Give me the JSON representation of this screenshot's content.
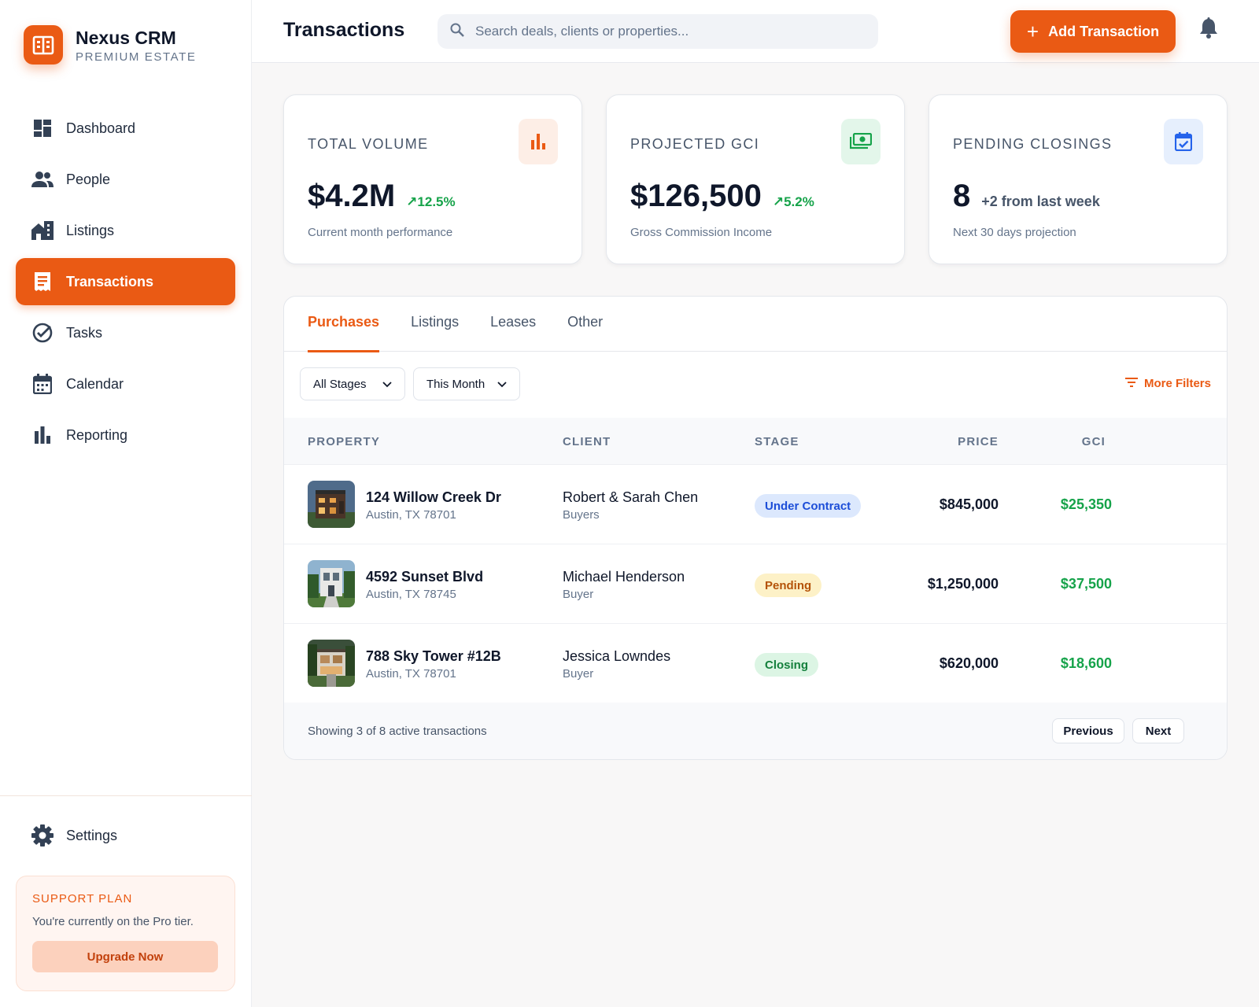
{
  "brand": {
    "name": "Nexus CRM",
    "subtitle": "PREMIUM ESTATE"
  },
  "nav": [
    {
      "label": "Dashboard",
      "icon": "dashboard-icon",
      "active": false
    },
    {
      "label": "People",
      "icon": "people-icon",
      "active": false
    },
    {
      "label": "Listings",
      "icon": "listings-icon",
      "active": false
    },
    {
      "label": "Transactions",
      "icon": "transactions-icon",
      "active": true
    },
    {
      "label": "Tasks",
      "icon": "tasks-icon",
      "active": false
    },
    {
      "label": "Calendar",
      "icon": "calendar-icon",
      "active": false
    },
    {
      "label": "Reporting",
      "icon": "reporting-icon",
      "active": false
    }
  ],
  "settings": {
    "label": "Settings",
    "icon": "gear-icon"
  },
  "support": {
    "title": "SUPPORT PLAN",
    "text": "You're currently on the Pro tier.",
    "button": "Upgrade Now"
  },
  "header": {
    "title": "Transactions",
    "search_placeholder": "Search deals, clients or properties...",
    "add_button": "Add Transaction"
  },
  "stats": [
    {
      "label": "TOTAL VOLUME",
      "value": "$4.2M",
      "delta": "12.5%",
      "sub": "Current month performance",
      "icon": "bar-chart-icon"
    },
    {
      "label": "PROJECTED GCI",
      "value": "$126,500",
      "delta": "5.2%",
      "sub": "Gross Commission Income",
      "icon": "money-icon"
    },
    {
      "label": "PENDING CLOSINGS",
      "value": "8",
      "delta": "+2 from last week",
      "sub": "Next 30 days projection",
      "icon": "calendar-check-icon"
    }
  ],
  "tabs": [
    "Purchases",
    "Listings",
    "Leases",
    "Other"
  ],
  "active_tab": "Purchases",
  "filters": {
    "stage": "All Stages",
    "period": "This Month",
    "more": "More Filters"
  },
  "table": {
    "headers": {
      "property": "PROPERTY",
      "client": "CLIENT",
      "stage": "STAGE",
      "price": "PRICE",
      "gci": "GCI"
    },
    "rows": [
      {
        "property": "124 Willow Creek Dr",
        "address": "Austin, TX 78701",
        "client": "Robert & Sarah Chen",
        "role": "Buyers",
        "stage": "Under Contract",
        "price": "$845,000",
        "gci": "$25,350"
      },
      {
        "property": "4592 Sunset Blvd",
        "address": "Austin, TX 78745",
        "client": "Michael Henderson",
        "role": "Buyer",
        "stage": "Pending",
        "price": "$1,250,000",
        "gci": "$37,500"
      },
      {
        "property": "788 Sky Tower #12B",
        "address": "Austin, TX 78701",
        "client": "Jessica Lowndes",
        "role": "Buyer",
        "stage": "Closing",
        "price": "$620,000",
        "gci": "$18,600"
      }
    ]
  },
  "footer": {
    "showing": "Showing 3 of 8 active transactions",
    "previous": "Previous",
    "next": "Next"
  },
  "colors": {
    "accent": "#ea5a14",
    "positive": "#16a34a",
    "under_contract": "#1d4ed8",
    "pending": "#b45309",
    "closing": "#15803d"
  }
}
